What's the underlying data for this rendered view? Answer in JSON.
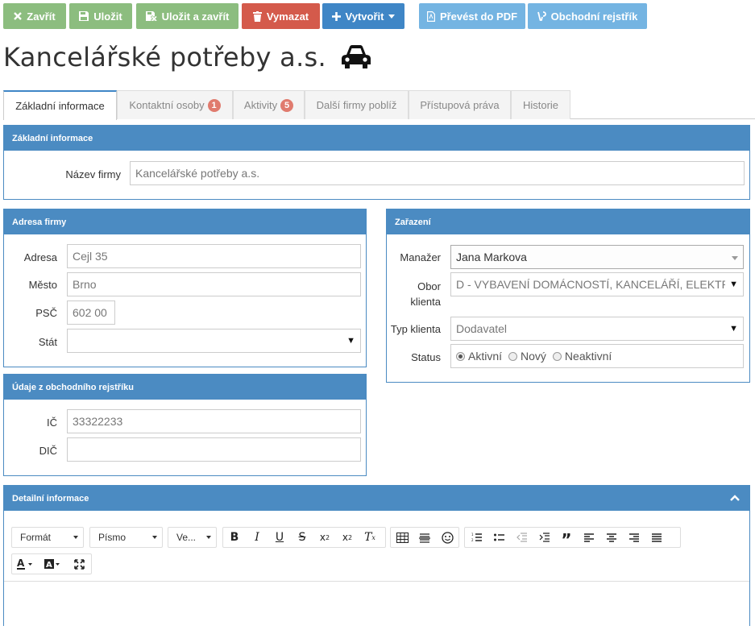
{
  "toolbar": {
    "close": "Zavřít",
    "save": "Uložit",
    "save_close": "Uložit a zavřít",
    "delete": "Vymazat",
    "create": "Vytvořit",
    "pdf": "Převést do PDF",
    "registry": "Obchodní rejstřík"
  },
  "page_title": "Kancelářské potřeby a.s.",
  "tabs": [
    {
      "label": "Základní informace"
    },
    {
      "label": "Kontaktní osoby",
      "badge": "1"
    },
    {
      "label": "Aktivity",
      "badge": "5"
    },
    {
      "label": "Další firmy poblíž"
    },
    {
      "label": "Přístupová práva"
    },
    {
      "label": "Historie"
    }
  ],
  "basic": {
    "heading": "Základní informace",
    "name_label": "Název firmy",
    "name_value": "Kancelářské potřeby a.s."
  },
  "address": {
    "heading": "Adresa firmy",
    "street_label": "Adresa",
    "street_value": "Cejl 35",
    "city_label": "Město",
    "city_value": "Brno",
    "zip_label": "PSČ",
    "zip_value": "602 00",
    "country_label": "Stát",
    "country_value": ""
  },
  "registry": {
    "heading": "Údaje z obchodního rejstříku",
    "ic_label": "IČ",
    "ic_value": "33322233",
    "dic_label": "DIČ",
    "dic_value": ""
  },
  "classification": {
    "heading": "Zařazení",
    "manager_label": "Manažer",
    "manager_value": "Jana Markova",
    "field_label_1": "Obor",
    "field_label_2": "klienta",
    "field_value": "D - VYBAVENÍ DOMÁCNOSTÍ, KANCELÁŘÍ, ELEKTRC",
    "type_label": "Typ klienta",
    "type_value": "Dodavatel",
    "status_label": "Status",
    "status_options": [
      "Aktivní",
      "Nový",
      "Neaktivní"
    ],
    "status_selected": "Aktivní"
  },
  "detail": {
    "heading": "Detailní informace",
    "format": "Formát",
    "font": "Písmo",
    "size": "Ve..."
  }
}
